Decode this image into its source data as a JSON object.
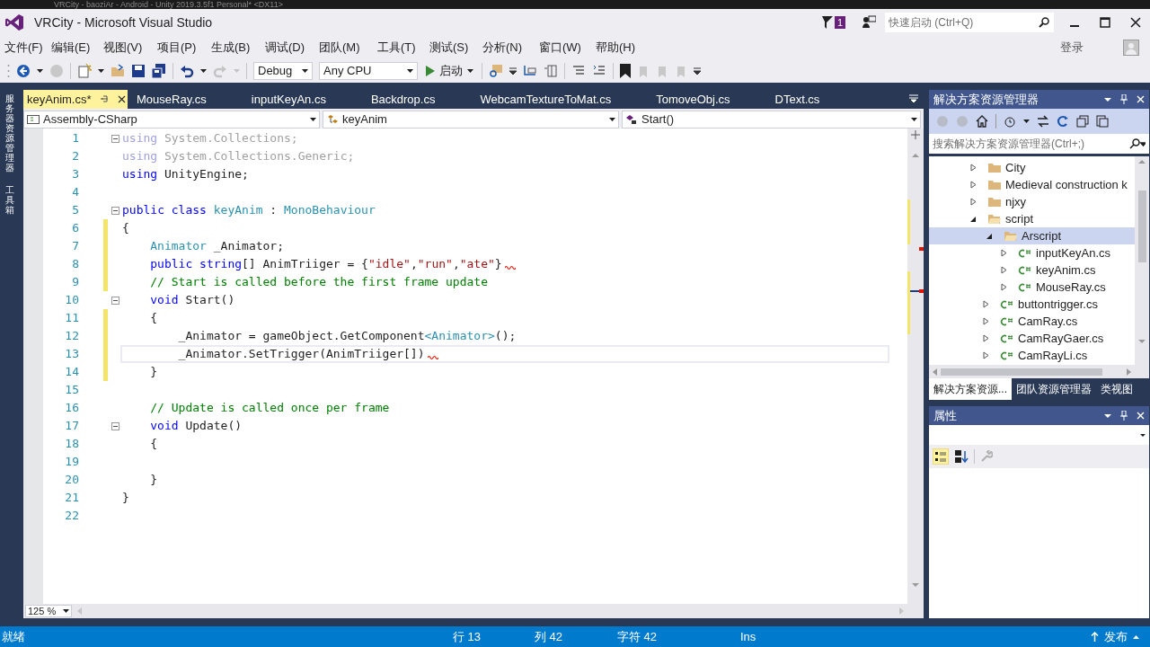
{
  "background_window": {
    "title": "VRCity - baoziAr - Android - Unity 2019.3.5f1 Personal* <DX11>"
  },
  "window": {
    "title": "VRCity - Microsoft Visual Studio",
    "notification_count": "1",
    "quick_launch": {
      "placeholder": "快速启动 (Ctrl+Q)"
    },
    "sign_in": "登录"
  },
  "menu": [
    "文件(F)",
    "编辑(E)",
    "视图(V)",
    "项目(P)",
    "生成(B)",
    "调试(D)",
    "团队(M)",
    "工具(T)",
    "测试(S)",
    "分析(N)",
    "窗口(W)",
    "帮助(H)"
  ],
  "toolbar": {
    "configuration": "Debug",
    "platform": "Any CPU",
    "start": "启动"
  },
  "side_strip": [
    "服务器资源管理器",
    "工具箱"
  ],
  "editor": {
    "tabs": [
      {
        "label": "keyAnim.cs*",
        "selected": true
      },
      {
        "label": "MouseRay.cs",
        "selected": false
      },
      {
        "label": "inputKeyAn.cs",
        "selected": false
      },
      {
        "label": "Backdrop.cs",
        "selected": false
      },
      {
        "label": "WebcamTextureToMat.cs",
        "selected": false
      },
      {
        "label": "TomoveObj.cs",
        "selected": false
      },
      {
        "label": "DText.cs",
        "selected": false
      }
    ],
    "nav": [
      "Assembly-CSharp",
      "keyAnim",
      "Start()"
    ],
    "lines": [
      {
        "number": "1",
        "fold": true,
        "faded": true,
        "modified": false,
        "current": false,
        "squiggle": false,
        "tokens": [
          {
            "kind": "keyword",
            "text": "using"
          },
          {
            "kind": "plain",
            "text": " System.Collections;"
          }
        ]
      },
      {
        "number": "2",
        "fold": false,
        "faded": true,
        "modified": false,
        "current": false,
        "squiggle": false,
        "tokens": [
          {
            "kind": "keyword",
            "text": "using"
          },
          {
            "kind": "plain",
            "text": " System.Collections.Generic;"
          }
        ]
      },
      {
        "number": "3",
        "fold": false,
        "faded": false,
        "modified": false,
        "current": false,
        "squiggle": false,
        "tokens": [
          {
            "kind": "keyword",
            "text": "using"
          },
          {
            "kind": "plain",
            "text": " UnityEngine;"
          }
        ]
      },
      {
        "number": "4",
        "fold": false,
        "faded": false,
        "modified": false,
        "current": false,
        "squiggle": false
      },
      {
        "number": "5",
        "fold": true,
        "faded": false,
        "modified": false,
        "current": false,
        "squiggle": false,
        "tokens": [
          {
            "kind": "keyword",
            "text": "public class"
          },
          {
            "kind": "type",
            "text": " keyAnim"
          },
          {
            "kind": "plain",
            "text": " : "
          },
          {
            "kind": "type",
            "text": "MonoBehaviour"
          }
        ]
      },
      {
        "number": "6",
        "fold": false,
        "faded": false,
        "modified": true,
        "current": false,
        "squiggle": false,
        "tokens": [
          {
            "kind": "plain",
            "text": "{"
          }
        ]
      },
      {
        "number": "7",
        "fold": false,
        "faded": false,
        "modified": true,
        "current": false,
        "squiggle": false,
        "tokens": [
          {
            "kind": "type",
            "text": "    Animator"
          },
          {
            "kind": "plain",
            "text": " _Animator;"
          }
        ]
      },
      {
        "number": "8",
        "fold": false,
        "faded": false,
        "modified": true,
        "current": false,
        "squiggle": true,
        "tokens": [
          {
            "kind": "keyword",
            "text": "    public string"
          },
          {
            "kind": "plain",
            "text": "[] AnimTriiger = {"
          },
          {
            "kind": "string",
            "text": "\"idle\""
          },
          {
            "kind": "plain",
            "text": ","
          },
          {
            "kind": "string",
            "text": "\"run\""
          },
          {
            "kind": "plain",
            "text": ","
          },
          {
            "kind": "string",
            "text": "\"ate\""
          },
          {
            "kind": "plain",
            "text": "}"
          }
        ]
      },
      {
        "number": "9",
        "fold": false,
        "faded": false,
        "modified": true,
        "current": false,
        "squiggle": false,
        "tokens": [
          {
            "kind": "comment",
            "text": "    // Start is called before the first frame update"
          }
        ]
      },
      {
        "number": "10",
        "fold": true,
        "faded": false,
        "modified": false,
        "current": false,
        "squiggle": false,
        "tokens": [
          {
            "kind": "keyword",
            "text": "    void"
          },
          {
            "kind": "plain",
            "text": " Start()"
          }
        ]
      },
      {
        "number": "11",
        "fold": false,
        "faded": false,
        "modified": true,
        "current": false,
        "squiggle": false,
        "tokens": [
          {
            "kind": "plain",
            "text": "    {"
          }
        ]
      },
      {
        "number": "12",
        "fold": false,
        "faded": false,
        "modified": true,
        "current": false,
        "squiggle": false,
        "tokens": [
          {
            "kind": "plain",
            "text": "        _Animator = gameObject.GetComponent"
          },
          {
            "kind": "type",
            "text": "<Animator>"
          },
          {
            "kind": "plain",
            "text": "();"
          }
        ]
      },
      {
        "number": "13",
        "fold": false,
        "faded": false,
        "modified": true,
        "current": true,
        "squiggle": true,
        "tokens": [
          {
            "kind": "plain",
            "text": "        _Animator.SetTrigger(AnimTriiger[])"
          }
        ]
      },
      {
        "number": "14",
        "fold": false,
        "faded": false,
        "modified": true,
        "current": false,
        "squiggle": false,
        "tokens": [
          {
            "kind": "plain",
            "text": "    }"
          }
        ]
      },
      {
        "number": "15",
        "fold": false,
        "faded": false,
        "modified": false,
        "current": false,
        "squiggle": false
      },
      {
        "number": "16",
        "fold": false,
        "faded": false,
        "modified": false,
        "current": false,
        "squiggle": false,
        "tokens": [
          {
            "kind": "comment",
            "text": "    // Update is called once per frame"
          }
        ]
      },
      {
        "number": "17",
        "fold": true,
        "faded": false,
        "modified": false,
        "current": false,
        "squiggle": false,
        "tokens": [
          {
            "kind": "keyword",
            "text": "    void"
          },
          {
            "kind": "plain",
            "text": " Update()"
          }
        ]
      },
      {
        "number": "18",
        "fold": false,
        "faded": false,
        "modified": false,
        "current": false,
        "squiggle": false,
        "tokens": [
          {
            "kind": "plain",
            "text": "    {"
          }
        ]
      },
      {
        "number": "19",
        "fold": false,
        "faded": false,
        "modified": false,
        "current": false,
        "squiggle": false
      },
      {
        "number": "20",
        "fold": false,
        "faded": false,
        "modified": false,
        "current": false,
        "squiggle": false,
        "tokens": [
          {
            "kind": "plain",
            "text": "    }"
          }
        ]
      },
      {
        "number": "21",
        "fold": false,
        "faded": false,
        "modified": false,
        "current": false,
        "squiggle": false,
        "tokens": [
          {
            "kind": "plain",
            "text": "}"
          }
        ]
      },
      {
        "number": "22",
        "fold": false,
        "faded": false,
        "modified": false,
        "current": false,
        "squiggle": false
      }
    ],
    "zoom": "125 %"
  },
  "solution_explorer": {
    "title": "解决方案资源管理器",
    "search": {
      "placeholder": "搜索解决方案资源管理器(Ctrl+;)"
    },
    "tree": [
      {
        "label": "City",
        "kind": "folder",
        "expanded": false,
        "selected": false
      },
      {
        "label": "Medieval construction k",
        "kind": "folder",
        "expanded": false,
        "selected": false
      },
      {
        "label": "njxy",
        "kind": "folder",
        "expanded": false,
        "selected": false
      },
      {
        "label": "script",
        "kind": "folder",
        "expanded": true,
        "selected": false,
        "children": [
          {
            "label": "Arscript",
            "kind": "folder",
            "expanded": true,
            "selected": true,
            "children": [
              {
                "label": "inputKeyAn.cs",
                "kind": "csfile",
                "expanded": false,
                "selected": false
              },
              {
                "label": "keyAnim.cs",
                "kind": "csfile",
                "expanded": false,
                "selected": false
              },
              {
                "label": "MouseRay.cs",
                "kind": "csfile",
                "expanded": false,
                "selected": false
              }
            ]
          },
          {
            "label": "buttontrigger.cs",
            "kind": "csfile",
            "expanded": false,
            "selected": false
          },
          {
            "label": "CamRay.cs",
            "kind": "csfile",
            "expanded": false,
            "selected": false
          },
          {
            "label": "CamRayGaer.cs",
            "kind": "csfile",
            "expanded": false,
            "selected": false
          },
          {
            "label": "CamRayLi.cs",
            "kind": "csfile",
            "expanded": false,
            "selected": false
          }
        ]
      }
    ],
    "tabs": [
      {
        "label": "解决方案资源...",
        "selected": true
      },
      {
        "label": "团队资源管理器",
        "selected": false
      },
      {
        "label": "类视图",
        "selected": false
      }
    ]
  },
  "properties": {
    "title": "属性"
  },
  "status_bar": {
    "state": "就绪",
    "line": "行 13",
    "column": "列 42",
    "char": "字符 42",
    "mode": "Ins",
    "publish": "发布"
  }
}
